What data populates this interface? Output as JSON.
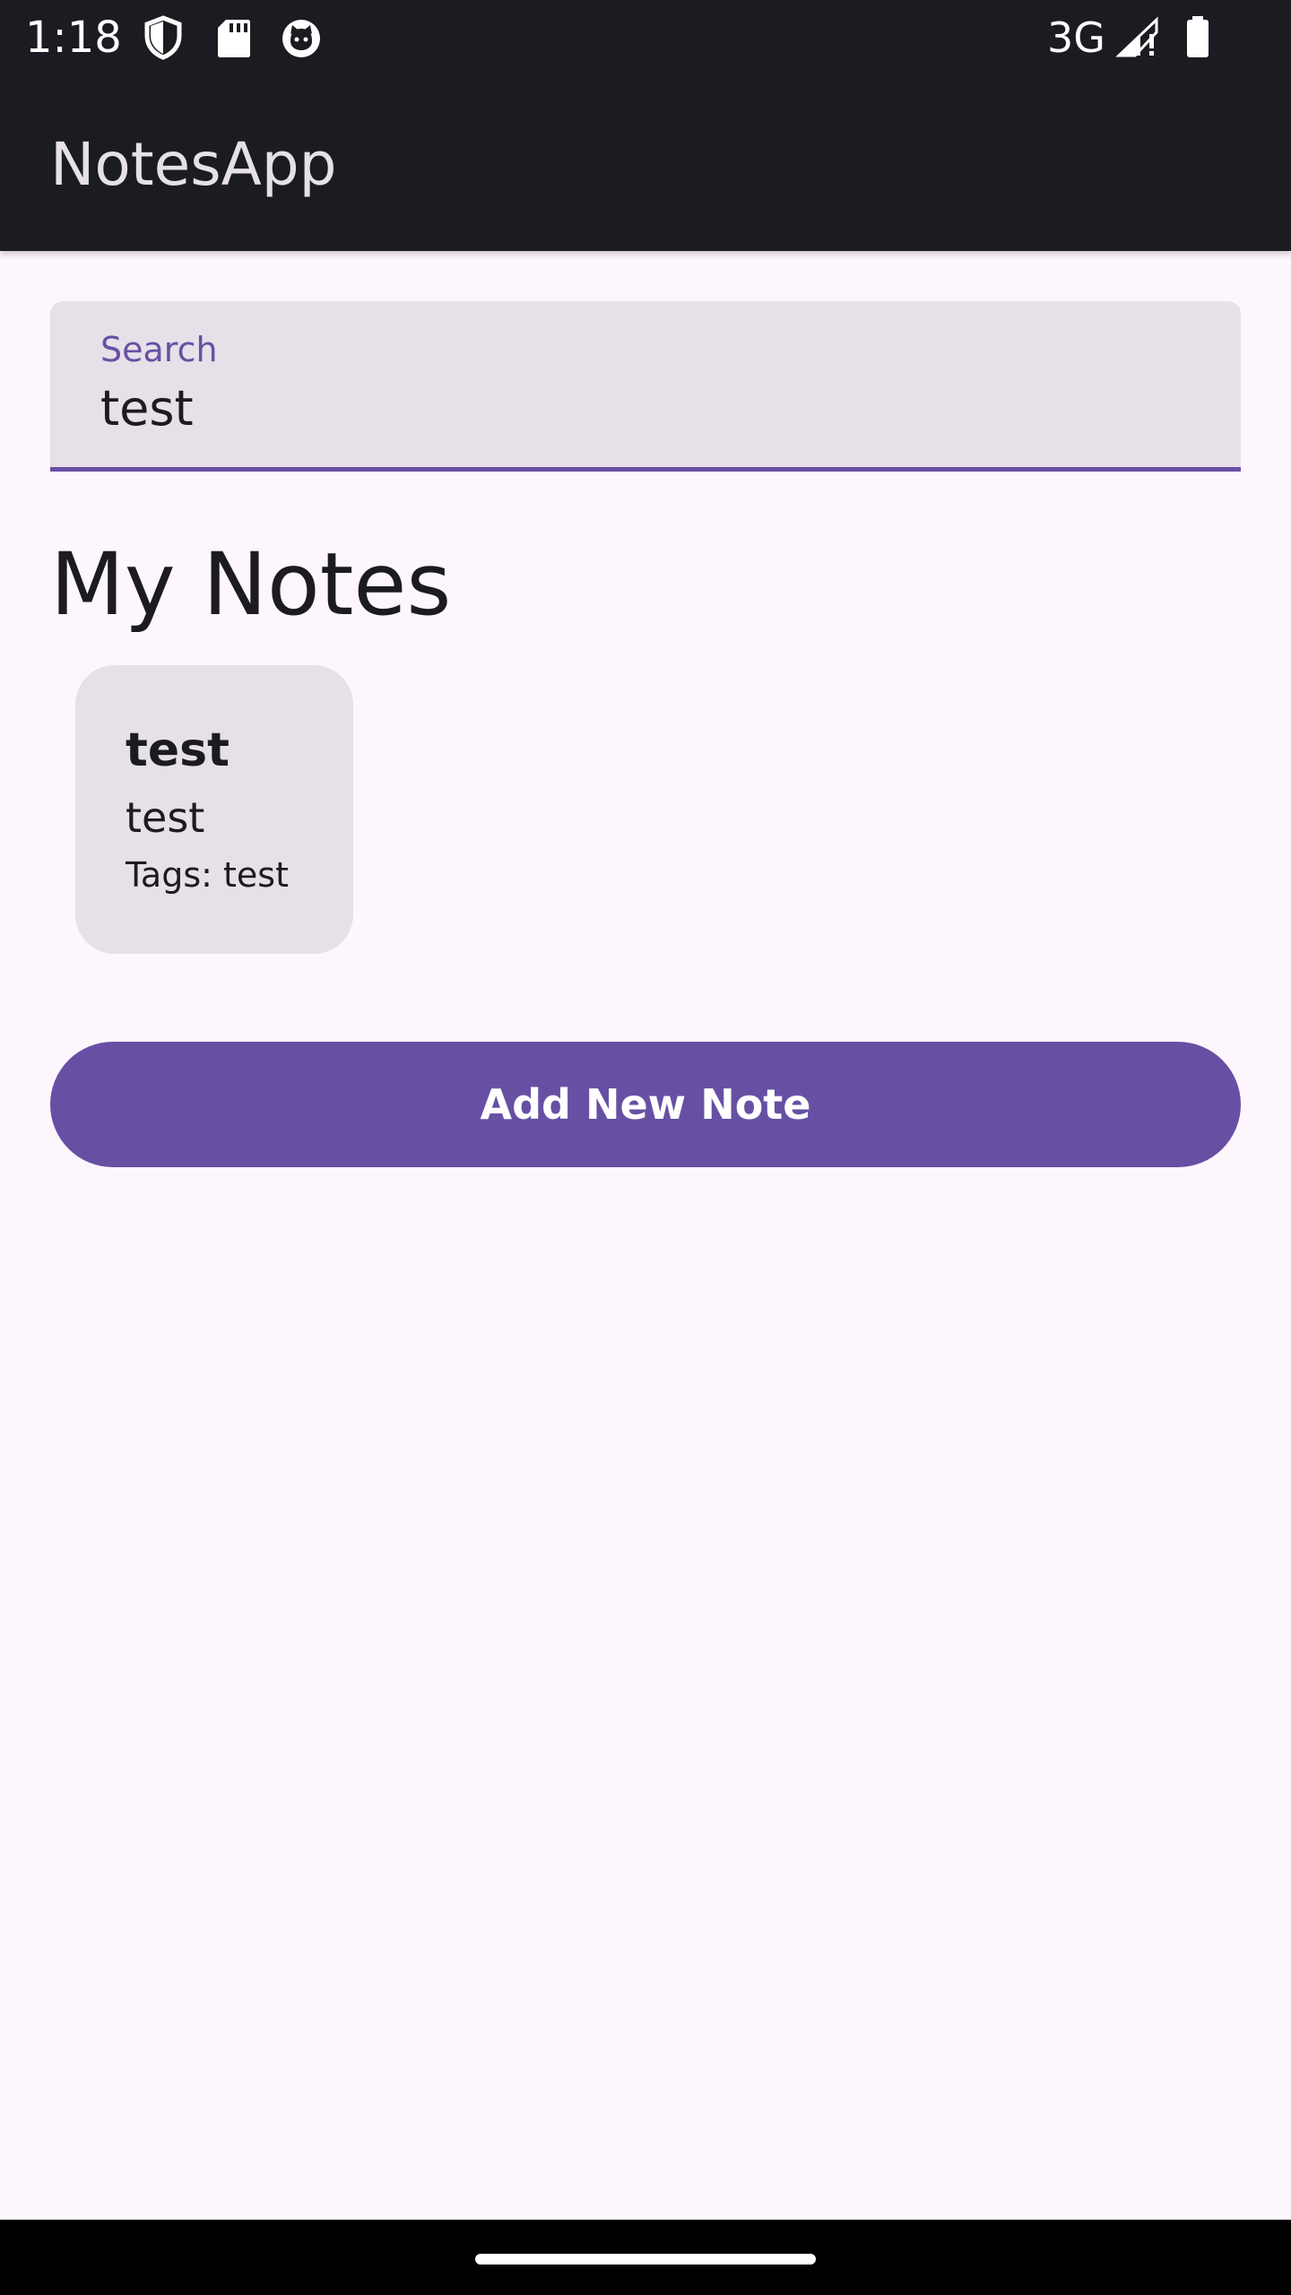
{
  "status_bar": {
    "time": "1:18",
    "network": "3G",
    "icons": [
      "shield-icon",
      "sd-card-icon",
      "cat-face-icon",
      "signal-icon",
      "battery-icon"
    ]
  },
  "app_bar": {
    "title": "NotesApp"
  },
  "search": {
    "label": "Search",
    "value": "test"
  },
  "section": {
    "title": "My Notes"
  },
  "notes": [
    {
      "title": "test",
      "body": "test",
      "tags": "Tags: test"
    }
  ],
  "actions": {
    "add_label": "Add New Note"
  },
  "colors": {
    "primary": "#6750a4",
    "background": "#fdf7fd",
    "surface_variant": "#e6e0e8",
    "bar": "#1b1c21"
  }
}
